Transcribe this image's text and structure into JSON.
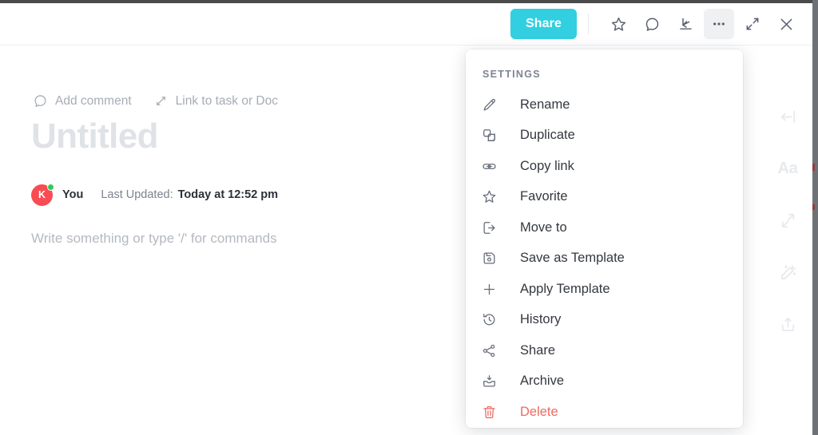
{
  "window": {
    "top_bar_color": "#4a4a4a",
    "right_bar_color": "#6e7277"
  },
  "header": {
    "share_label": "Share",
    "actions": [
      {
        "name": "favorite-star-icon",
        "icon": "star",
        "active": false
      },
      {
        "name": "comment-icon",
        "icon": "comment",
        "active": false
      },
      {
        "name": "collapse-down-right-icon",
        "icon": "arrow-down-right",
        "active": false
      },
      {
        "name": "more-options-icon",
        "icon": "ellipsis",
        "active": true
      },
      {
        "name": "expand-fullscreen-icon",
        "icon": "expand",
        "active": false
      },
      {
        "name": "close-icon",
        "icon": "close",
        "active": false
      }
    ],
    "accent_color": "#32cfe0"
  },
  "document": {
    "actions": [
      {
        "icon": "comment",
        "label": "Add comment"
      },
      {
        "icon": "link-task",
        "label": "Link to task or Doc"
      }
    ],
    "title": "Untitled",
    "title_is_placeholder": true,
    "meta": {
      "avatar_initial": "K",
      "avatar_color": "#f94b53",
      "presence_color": "#2ecb5c",
      "user": "You",
      "updated_label": "Last Updated:",
      "updated_value": "Today at 12:52 pm"
    },
    "body_placeholder": "Write something or type '/' for commands"
  },
  "rail": {
    "items": [
      {
        "name": "collapse-sidebar-icon",
        "icon": "collapse-left",
        "label": ""
      },
      {
        "name": "font-size-icon",
        "icon": "aa",
        "label": "Aa"
      },
      {
        "name": "relationships-icon",
        "icon": "arrows-diagonal",
        "label": ""
      },
      {
        "name": "ai-sparkle-icon",
        "icon": "magic-wand",
        "label": ""
      },
      {
        "name": "export-share-icon",
        "icon": "upload",
        "label": ""
      }
    ]
  },
  "menu": {
    "heading": "SETTINGS",
    "items": [
      {
        "id": "rename",
        "icon": "pencil",
        "label": "Rename",
        "danger": false
      },
      {
        "id": "duplicate",
        "icon": "duplicate",
        "label": "Duplicate",
        "danger": false
      },
      {
        "id": "copy-link",
        "icon": "link",
        "label": "Copy link",
        "danger": false
      },
      {
        "id": "favorite",
        "icon": "star",
        "label": "Favorite",
        "danger": false
      },
      {
        "id": "move-to",
        "icon": "move-to",
        "label": "Move to",
        "danger": false
      },
      {
        "id": "save-template",
        "icon": "save",
        "label": "Save as Template",
        "danger": false
      },
      {
        "id": "apply-template",
        "icon": "plus",
        "label": "Apply Template",
        "danger": false
      },
      {
        "id": "history",
        "icon": "history",
        "label": "History",
        "danger": false
      },
      {
        "id": "share",
        "icon": "share",
        "label": "Share",
        "danger": false
      },
      {
        "id": "archive",
        "icon": "archive",
        "label": "Archive",
        "danger": false
      },
      {
        "id": "delete",
        "icon": "trash",
        "label": "Delete",
        "danger": true
      }
    ],
    "danger_color": "#ed6a62"
  }
}
